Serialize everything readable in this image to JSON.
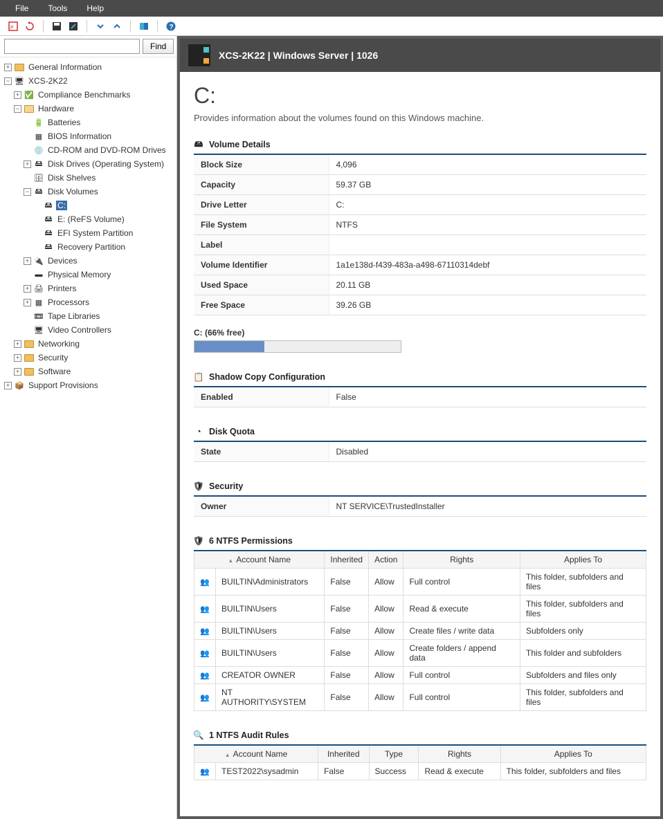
{
  "menu": {
    "file": "File",
    "tools": "Tools",
    "help": "Help"
  },
  "search": {
    "placeholder": "",
    "button": "Find"
  },
  "tree": {
    "general": "General Information",
    "host": "XCS-2K22",
    "compliance": "Compliance Benchmarks",
    "hardware": "Hardware",
    "batteries": "Batteries",
    "bios": "BIOS Information",
    "cdrom": "CD-ROM and DVD-ROM Drives",
    "diskdrives": "Disk Drives (Operating System)",
    "shelves": "Disk Shelves",
    "volumes": "Disk Volumes",
    "c": "C:",
    "e": "E: (ReFS Volume)",
    "efi": "EFI System Partition",
    "recovery": "Recovery Partition",
    "devices": "Devices",
    "physmem": "Physical Memory",
    "printers": "Printers",
    "processors": "Processors",
    "tape": "Tape Libraries",
    "video": "Video Controllers",
    "networking": "Networking",
    "security": "Security",
    "software": "Software",
    "support": "Support Provisions"
  },
  "banner": {
    "title": "XCS-2K22 | Windows Server | 1026"
  },
  "page": {
    "heading": "C:",
    "description": "Provides information about the volumes found on this Windows machine."
  },
  "sections": {
    "volume_details": "Volume Details",
    "shadow": "Shadow Copy Configuration",
    "quota": "Disk Quota",
    "security": "Security",
    "perms": "6 NTFS Permissions",
    "audit": "1 NTFS Audit Rules"
  },
  "volume": {
    "block_k": "Block Size",
    "block_v": "4,096",
    "cap_k": "Capacity",
    "cap_v": "59.37 GB",
    "letter_k": "Drive Letter",
    "letter_v": "C:",
    "fs_k": "File System",
    "fs_v": "NTFS",
    "label_k": "Label",
    "label_v": "",
    "id_k": "Volume Identifier",
    "id_v": "1a1e138d-f439-483a-a498-67110314debf",
    "used_k": "Used Space",
    "used_v": "20.11 GB",
    "free_k": "Free Space",
    "free_v": "39.26 GB"
  },
  "usage": {
    "label": "C: (66% free)",
    "used_percent": 34
  },
  "shadow": {
    "enabled_k": "Enabled",
    "enabled_v": "False"
  },
  "quota": {
    "state_k": "State",
    "state_v": "Disabled"
  },
  "security_tbl": {
    "owner_k": "Owner",
    "owner_v": "NT SERVICE\\TrustedInstaller"
  },
  "perm_headers": {
    "account": "Account Name",
    "inherited": "Inherited",
    "action": "Action",
    "rights": "Rights",
    "applies": "Applies To"
  },
  "perms": [
    {
      "account": "BUILTIN\\Administrators",
      "inherited": "False",
      "action": "Allow",
      "rights": "Full control",
      "applies": "This folder, subfolders and files"
    },
    {
      "account": "BUILTIN\\Users",
      "inherited": "False",
      "action": "Allow",
      "rights": "Read & execute",
      "applies": "This folder, subfolders and files"
    },
    {
      "account": "BUILTIN\\Users",
      "inherited": "False",
      "action": "Allow",
      "rights": "Create files / write data",
      "applies": "Subfolders only"
    },
    {
      "account": "BUILTIN\\Users",
      "inherited": "False",
      "action": "Allow",
      "rights": "Create folders / append data",
      "applies": "This folder and subfolders"
    },
    {
      "account": "CREATOR OWNER",
      "inherited": "False",
      "action": "Allow",
      "rights": "Full control",
      "applies": "Subfolders and files only"
    },
    {
      "account": "NT AUTHORITY\\SYSTEM",
      "inherited": "False",
      "action": "Allow",
      "rights": "Full control",
      "applies": "This folder, subfolders and files"
    }
  ],
  "audit_headers": {
    "account": "Account Name",
    "inherited": "Inherited",
    "type": "Type",
    "rights": "Rights",
    "applies": "Applies To"
  },
  "audit": [
    {
      "account": "TEST2022\\sysadmin",
      "inherited": "False",
      "type": "Success",
      "rights": "Read & execute",
      "applies": "This folder, subfolders and files"
    }
  ]
}
